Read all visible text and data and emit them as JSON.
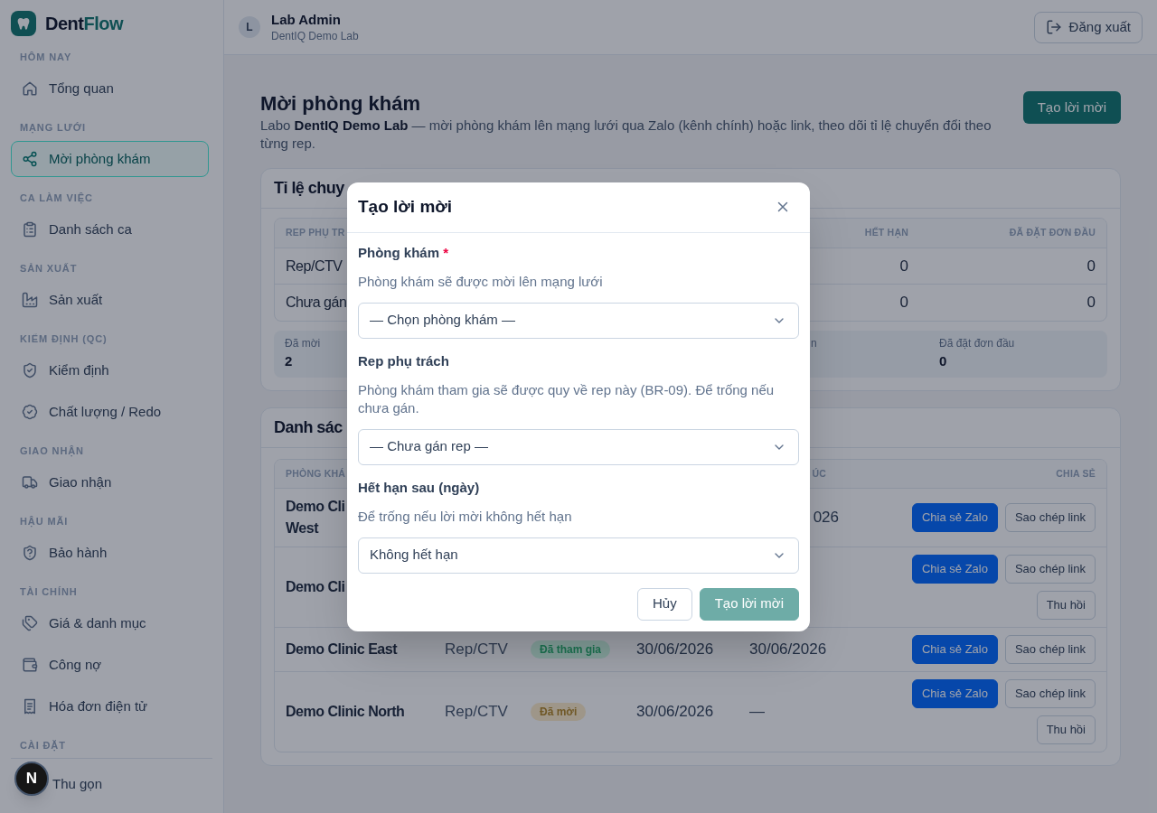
{
  "sidebar": {
    "brand": {
      "text": "Dent",
      "accent": "Flow"
    },
    "sections": [
      {
        "heading": "HÔM NAY",
        "items": [
          {
            "label": "Tổng quan",
            "selected": false
          }
        ]
      },
      {
        "heading": "MẠNG LƯỚI",
        "items": [
          {
            "label": "Mời phòng khám",
            "selected": true
          }
        ]
      },
      {
        "heading": "CA LÀM VIỆC",
        "items": [
          {
            "label": "Danh sách ca",
            "selected": false
          }
        ]
      },
      {
        "heading": "SẢN XUẤT",
        "items": [
          {
            "label": "Sản xuất",
            "selected": false
          }
        ]
      },
      {
        "heading": "KIỂM ĐỊNH (QC)",
        "items": [
          {
            "label": "Kiểm định",
            "selected": false
          },
          {
            "label": "Chất lượng / Redo",
            "selected": false
          }
        ]
      },
      {
        "heading": "GIAO NHẬN",
        "items": [
          {
            "label": "Giao nhận",
            "selected": false
          }
        ]
      },
      {
        "heading": "HẬU MÃI",
        "items": [
          {
            "label": "Bảo hành",
            "selected": false
          }
        ]
      },
      {
        "heading": "TÀI CHÍNH",
        "items": [
          {
            "label": "Giá & danh mục",
            "selected": false
          },
          {
            "label": "Công nợ",
            "selected": false
          },
          {
            "label": "Hóa đơn điện tử",
            "selected": false
          }
        ]
      },
      {
        "heading": "CÀI ĐẶT"
      }
    ],
    "collapse": {
      "label": "Thu gọn"
    }
  },
  "header": {
    "user": {
      "initial": "L",
      "name": "Lab Admin",
      "org": "DentIQ Demo Lab"
    },
    "logout": {
      "label": "Đăng xuất"
    }
  },
  "page": {
    "title": "Mời phòng khám",
    "subtitle": "Labo **DentIQ Demo Lab** — mời phòng khám lên mạng lưới qua Zalo (kênh chính) hoặc link, theo dõi tỉ lệ chuyển đổi theo từng rep.",
    "action": {
      "label": "Tạo lời mời"
    }
  },
  "conversion": {
    "title": "Tỉ lệ chuy",
    "columns": [
      {
        "label": "REP PHỤ TR"
      },
      {
        "label": "HẾT HẠN"
      },
      {
        "label": "ĐÃ ĐẶT ĐƠN ĐẦU"
      }
    ],
    "rows": [
      [
        "Rep/CTV",
        "0",
        "0"
      ],
      [
        "Chưa gán",
        "0",
        "0"
      ]
    ],
    "stats": [
      {
        "kind": "full",
        "label": "Đã mời",
        "value": "2"
      },
      {
        "kind": "partial",
        "label": "n"
      },
      {
        "kind": "full",
        "label": "Đã đặt đơn đầu",
        "value": "0"
      }
    ]
  },
  "invites": {
    "title": "Danh sác",
    "columns": [
      {
        "label": "PHÒNG KHÁ"
      },
      {
        "label": "ÚC"
      },
      {
        "label": "CHIA SẺ"
      }
    ],
    "rows": [
      {
        "kind": "partial",
        "column_1": "Demo Cli\nWest",
        "column_5": "026",
        "actions": [
          {
            "label": "Chia sẻ Zalo",
            "kind": "primary"
          },
          {
            "label": "Sao chép link",
            "kind": "secondary"
          }
        ]
      },
      {
        "kind": "partial",
        "column_1": "Demo Cli",
        "actions": [
          {
            "label": "Chia sẻ Zalo",
            "kind": "primary"
          },
          {
            "label": "Sao chép link",
            "kind": "secondary"
          },
          {
            "label": "Thu hồi",
            "kind": "secondary"
          }
        ]
      },
      {
        "kind": "full",
        "column_1": "Demo Clinic East",
        "column_2": "Rep/CTV",
        "column_3": {
          "label": "Đã tham gia",
          "color": "#839f9a"
        },
        "column_4": "30/06/2026",
        "column_5": "30/06/2026",
        "actions": [
          {
            "label": "Chia sẻ Zalo",
            "kind": "primary"
          },
          {
            "label": "Sao chép link",
            "kind": "secondary"
          }
        ]
      },
      {
        "kind": "full",
        "column_1": "Demo Clinic North",
        "column_2": "Rep/CTV",
        "column_3": {
          "label": "Đã mời",
          "color": "#9e9789"
        },
        "column_4": "30/06/2026",
        "column_5": "—",
        "actions": [
          {
            "label": "Chia sẻ Zalo",
            "kind": "primary"
          },
          {
            "label": "Sao chép link",
            "kind": "secondary"
          },
          {
            "label": "Thu hồi",
            "kind": "secondary"
          }
        ]
      }
    ]
  },
  "dialog": {
    "title": "Tạo lời mời",
    "fields": [
      {
        "label": "Phòng khám",
        "required_mark": "*",
        "hint": "Phòng khám sẽ được mời lên mạng lưới",
        "value": "— Chọn phòng khám —"
      },
      {
        "label": "Rep phụ trách",
        "hint": "Phòng khám tham gia sẽ được quy về rep này (BR-09). Để trống nếu chưa gán.",
        "value": "— Chưa gán rep —"
      },
      {
        "label": "Hết hạn sau (ngày)",
        "hint": "Để trống nếu lời mời không hết hạn",
        "value": "Không hết hạn"
      }
    ],
    "buttons": [
      {
        "label": "Hủy",
        "kind": "secondary",
        "disabled": false
      },
      {
        "label": "Tạo lời mời",
        "kind": "primary",
        "disabled": true
      }
    ]
  },
  "dev_badge": {
    "label": "N"
  }
}
